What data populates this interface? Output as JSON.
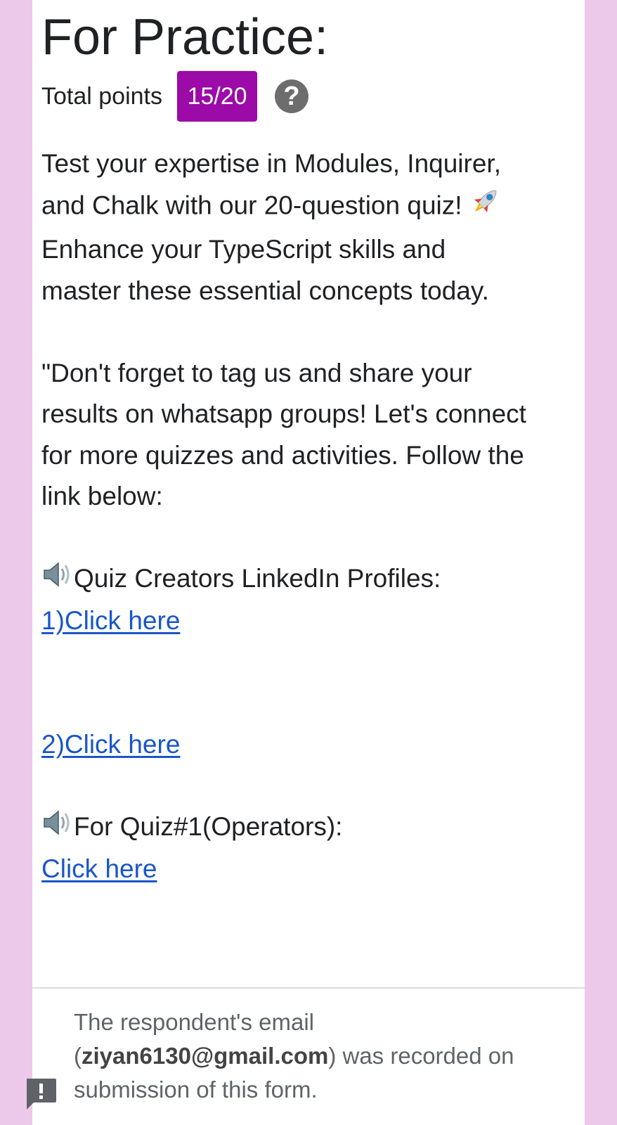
{
  "form": {
    "title": "For Practice:",
    "points_label": "Total points",
    "score": "15/20",
    "help_glyph": "?"
  },
  "description": {
    "line1": " Test your expertise in Modules, Inquirer, and Chalk with our 20-question quiz! ",
    "line1_rest": " Enhance your TypeScript skills and master these essential concepts today.",
    "paragraph2": "\"Don't forget to tag us and share your results on whatsapp groups! Let's connect for more quizzes and activities. Follow the link below:",
    "profiles_heading": "Quiz Creators LinkedIn Profiles:",
    "link1": "1)Click here",
    "link2": "2)Click here",
    "quiz1_heading": "For Quiz#1(Operators):",
    "link3": "Click here"
  },
  "footer": {
    "prefix": "The respondent's email (",
    "email": "ziyan6130@gmail.com",
    "suffix": ") was recorded on submission of this form."
  },
  "icons": {
    "help": "help-icon",
    "rocket": "rocket-emoji",
    "speaker": "speaker-emoji",
    "report": "report-problem-icon"
  },
  "colors": {
    "background": "#ecc9ea",
    "badge": "#9c0aa8",
    "link": "#1a56c8"
  }
}
